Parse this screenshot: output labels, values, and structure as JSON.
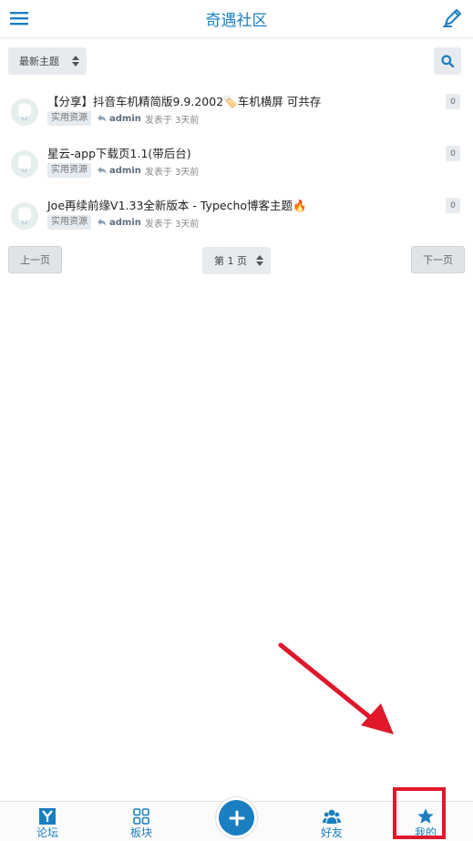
{
  "header": {
    "title": "奇遇社区",
    "menu_icon": "hamburger-menu-icon",
    "write_icon": "pen-icon",
    "accent_color": "#1a7fc1"
  },
  "toolbar": {
    "sort_value": "最新主题",
    "search_icon": "search-icon"
  },
  "topics": [
    {
      "title": "【分享】抖音车机精简版9.9.2002",
      "title_suffix": "车机横屏 可共存",
      "title_emoji": "🏷️",
      "tag": "实用资源",
      "author": "admin",
      "posted": "发表于 3天前",
      "replies": "0"
    },
    {
      "title": "星云-app下载页1.1(带后台)",
      "title_suffix": "",
      "title_emoji": "",
      "tag": "实用资源",
      "author": "admin",
      "posted": "发表于 3天前",
      "replies": "0"
    },
    {
      "title": "Joe再续前缘V1.33全新版本 - Typecho博客主题",
      "title_suffix": "",
      "title_emoji": "🔥",
      "tag": "实用资源",
      "author": "admin",
      "posted": "发表于 3天前",
      "replies": "0"
    }
  ],
  "pager": {
    "prev": "上一页",
    "current": "第 1 页",
    "next": "下一页"
  },
  "tabbar": {
    "forum": "论坛",
    "boards": "板块",
    "friends": "好友",
    "mine": "我的",
    "forum_icon": "y-logo-icon",
    "boards_icon": "grid-icon",
    "add_icon": "plus-icon",
    "friends_icon": "users-icon",
    "mine_icon": "star-icon"
  },
  "annotation_color": "#e0182a"
}
